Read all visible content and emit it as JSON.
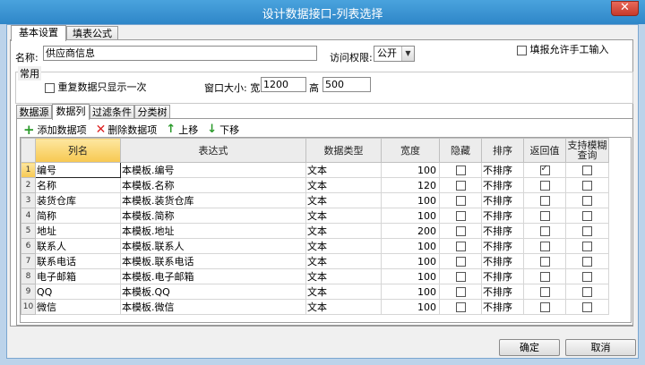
{
  "window": {
    "title": "设计数据接口-列表选择",
    "close_glyph": "✕"
  },
  "top_tabs": [
    {
      "label": "基本设置",
      "active": true
    },
    {
      "label": "填表公式",
      "active": false
    }
  ],
  "form": {
    "name_label": "名称:",
    "name_value": "供应商信息",
    "access_label": "访问权限:",
    "access_value": "公开",
    "manual_input_label": "填报允许手工输入",
    "manual_input_checked": false
  },
  "common": {
    "legend": "常用",
    "dedupe_label": "重复数据只显示一次",
    "dedupe_checked": false,
    "window_size_label": "窗口大小: 宽",
    "width_value": "1200",
    "height_label": "高",
    "height_value": "500"
  },
  "inner_tabs": [
    {
      "label": "数据源",
      "active": false
    },
    {
      "label": "数据列",
      "active": true
    },
    {
      "label": "过滤条件",
      "active": false
    },
    {
      "label": "分类树",
      "active": false
    }
  ],
  "toolbar": {
    "add_label": "添加数据项",
    "delete_label": "删除数据项",
    "up_label": "上移",
    "down_label": "下移"
  },
  "table": {
    "headers": [
      "列名",
      "表达式",
      "数据类型",
      "宽度",
      "隐藏",
      "排序",
      "返回值",
      "支持模糊查询"
    ],
    "rows": [
      {
        "n": "1",
        "name": "编号",
        "expr": "本模板.编号",
        "type": "文本",
        "width": "100",
        "hidden": false,
        "sort": "不排序",
        "ret": true,
        "fuzzy": false
      },
      {
        "n": "2",
        "name": "名称",
        "expr": "本模板.名称",
        "type": "文本",
        "width": "120",
        "hidden": false,
        "sort": "不排序",
        "ret": false,
        "fuzzy": false
      },
      {
        "n": "3",
        "name": "装货仓库",
        "expr": "本模板.装货仓库",
        "type": "文本",
        "width": "100",
        "hidden": false,
        "sort": "不排序",
        "ret": false,
        "fuzzy": false
      },
      {
        "n": "4",
        "name": "简称",
        "expr": "本模板.简称",
        "type": "文本",
        "width": "100",
        "hidden": false,
        "sort": "不排序",
        "ret": false,
        "fuzzy": false
      },
      {
        "n": "5",
        "name": "地址",
        "expr": "本模板.地址",
        "type": "文本",
        "width": "200",
        "hidden": false,
        "sort": "不排序",
        "ret": false,
        "fuzzy": false
      },
      {
        "n": "6",
        "name": "联系人",
        "expr": "本模板.联系人",
        "type": "文本",
        "width": "100",
        "hidden": false,
        "sort": "不排序",
        "ret": false,
        "fuzzy": false
      },
      {
        "n": "7",
        "name": "联系电话",
        "expr": "本模板.联系电话",
        "type": "文本",
        "width": "100",
        "hidden": false,
        "sort": "不排序",
        "ret": false,
        "fuzzy": false
      },
      {
        "n": "8",
        "name": "电子邮箱",
        "expr": "本模板.电子邮箱",
        "type": "文本",
        "width": "100",
        "hidden": false,
        "sort": "不排序",
        "ret": false,
        "fuzzy": false
      },
      {
        "n": "9",
        "name": "QQ",
        "expr": "本模板.QQ",
        "type": "文本",
        "width": "100",
        "hidden": false,
        "sort": "不排序",
        "ret": false,
        "fuzzy": false
      },
      {
        "n": "10",
        "name": "微信",
        "expr": "本模板.微信",
        "type": "文本",
        "width": "100",
        "hidden": false,
        "sort": "不排序",
        "ret": false,
        "fuzzy": false
      }
    ]
  },
  "buttons": {
    "ok": "确定",
    "cancel": "取消"
  }
}
